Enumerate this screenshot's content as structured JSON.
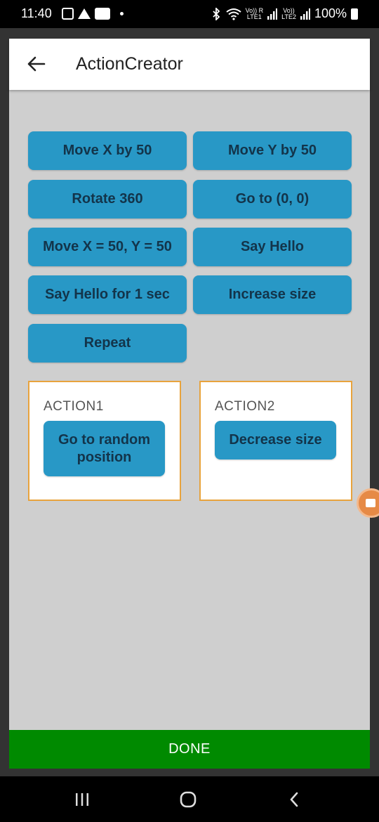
{
  "status_bar": {
    "time": "11:40",
    "battery": "100%",
    "left_icons": [
      "gallery-icon",
      "triangle-icon",
      "my-icon"
    ],
    "right_icons": [
      "bluetooth-icon",
      "wifi-icon",
      "signal-lte1-icon",
      "signal-lte2-icon",
      "battery-icon"
    ],
    "sim1": "Vo)) R\nLTE1",
    "sim2": "Vo))\nLTE2"
  },
  "appbar": {
    "title": "ActionCreator",
    "back_icon": "arrow-left-icon"
  },
  "actions": [
    "Move X by 50",
    "Move Y by 50",
    "Rotate 360",
    "Go to (0, 0)",
    "Move X = 50, Y = 50",
    "Say Hello",
    "Say Hello for 1 sec",
    "Increase size",
    "Repeat"
  ],
  "panels": [
    {
      "label": "ACTION1",
      "button": "Go to random position"
    },
    {
      "label": "ACTION2",
      "button": "Decrease size"
    }
  ],
  "done_label": "DONE",
  "colors": {
    "button": "#2898c6",
    "panel_border": "#e8a33d",
    "done": "#008a00",
    "background": "#cfcfcf"
  },
  "nav": {
    "icons": [
      "recents-icon",
      "home-icon",
      "back-icon"
    ]
  }
}
